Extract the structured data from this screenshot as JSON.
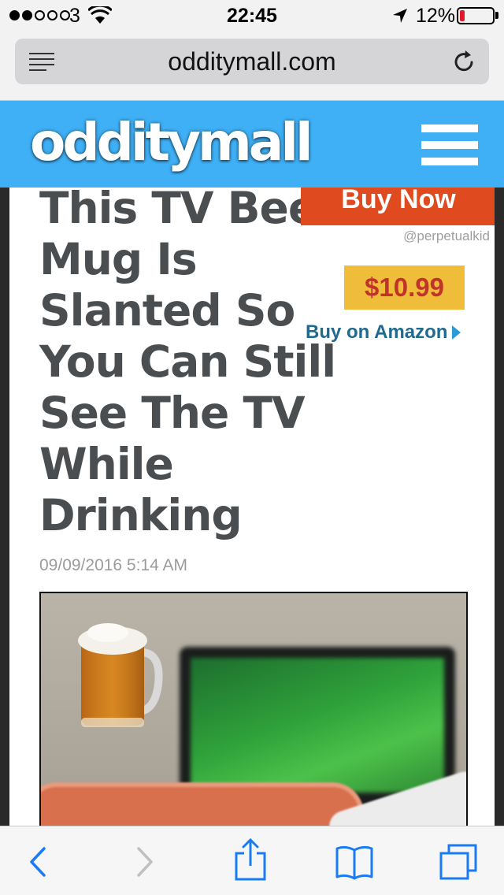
{
  "status_bar": {
    "carrier": "3",
    "time": "22:45",
    "battery_percent": "12%",
    "battery_level": 0.12,
    "signal_bars_filled": 2,
    "signal_bars_total": 5
  },
  "browser": {
    "url": "odditymall.com"
  },
  "site": {
    "logo": "odditymall",
    "brand_color": "#3fb0f6"
  },
  "article": {
    "title": "This TV Beer Mug Is Slanted So You Can Still See The TV While Drinking",
    "date": "09/09/2016 5:14 AM"
  },
  "product_box": {
    "buy_now": "Buy Now",
    "credit": "@perpetualkid",
    "price": "$10.99",
    "amazon_link": "Buy on Amazon",
    "buy_now_color": "#df4b1e",
    "price_bg_color": "#f0bd3a"
  },
  "toolbar": {
    "icons": [
      "back-icon",
      "forward-icon",
      "share-icon",
      "bookmarks-icon",
      "tabs-icon"
    ],
    "accent_color": "#1a7cf5"
  }
}
